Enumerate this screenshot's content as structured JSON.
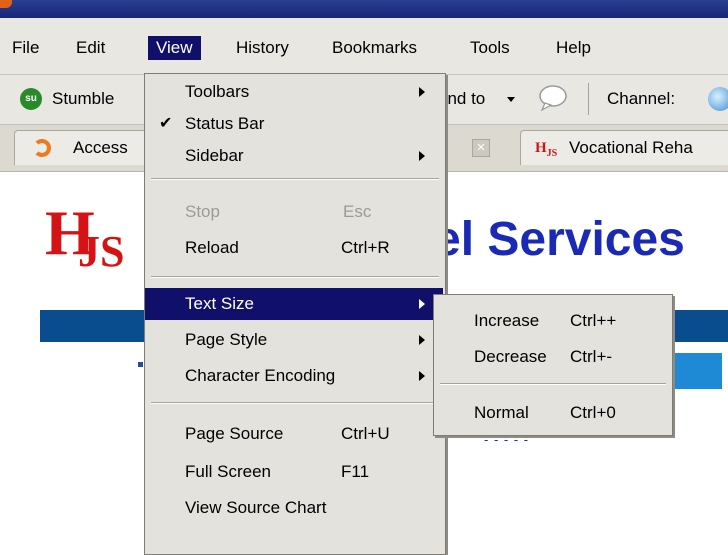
{
  "menubar": {
    "file": "File",
    "edit": "Edit",
    "view": "View",
    "history": "History",
    "bookmarks": "Bookmarks",
    "tools": "Tools",
    "help": "Help"
  },
  "toolbar": {
    "stumble": "Stumble",
    "send_to": "end to",
    "channel": "Channel:"
  },
  "tabs": {
    "tab1": "Access",
    "tab2": "Vocational Reha"
  },
  "page": {
    "logo_h": "H",
    "logo_js": "JS",
    "heading": "el Services"
  },
  "view_menu": {
    "toolbars": "Toolbars",
    "status_bar": "Status Bar",
    "status_bar_checked": true,
    "sidebar": "Sidebar",
    "stop": "Stop",
    "stop_shortcut": "Esc",
    "reload": "Reload",
    "reload_shortcut": "Ctrl+R",
    "text_size": "Text Size",
    "page_style": "Page Style",
    "character_encoding": "Character Encoding",
    "page_source": "Page Source",
    "page_source_shortcut": "Ctrl+U",
    "full_screen": "Full Screen",
    "full_screen_shortcut": "F11",
    "view_source_chart": "View Source Chart"
  },
  "text_size_menu": {
    "increase": "Increase",
    "increase_shortcut": "Ctrl++",
    "decrease": "Decrease",
    "decrease_shortcut": "Ctrl+-",
    "normal": "Normal",
    "normal_shortcut": "Ctrl+0"
  },
  "colors": {
    "menu_highlight": "#10106b",
    "menu_bg": "#e4e2dc",
    "logo_red": "#d41414",
    "heading_blue": "#1a2ab4"
  }
}
